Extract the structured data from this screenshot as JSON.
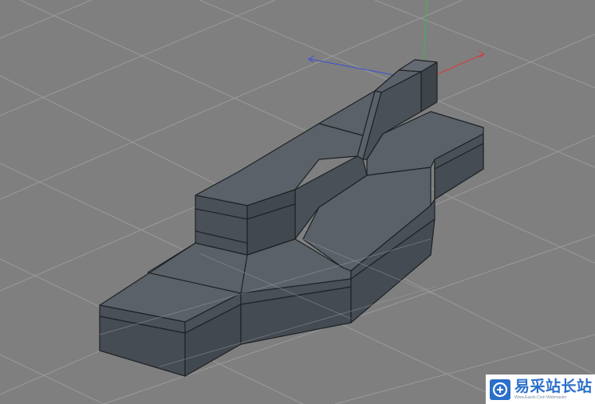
{
  "viewport": {
    "background_color": "#7f7f7f",
    "grid_color": "#9a9a9a",
    "axis_colors": {
      "x": "#d63b3b",
      "y": "#3cb84a",
      "z": "#3b4fd6"
    }
  },
  "model": {
    "face_colors": {
      "top": "#5b6168",
      "front": "#4a5057",
      "side": "#3f444a",
      "edge": "#1e2226"
    }
  },
  "watermark": {
    "title": "易采站长站",
    "subtitle": "Www.Easck.Com  Webmaster",
    "logo_icon": "easck-logo-icon",
    "brand_color": "#2a6fc9"
  }
}
